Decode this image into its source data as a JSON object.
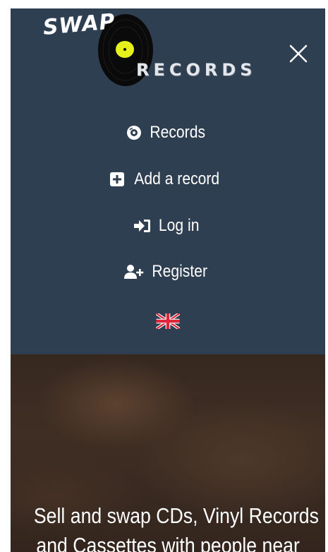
{
  "brand": {
    "logo_word_top": "SWAP",
    "logo_word_bottom": "RECORDS",
    "colors": {
      "nav_background": "#2f3f52",
      "disc": "#0a0a0a",
      "disc_label": "#e8f01c",
      "text": "#ffffff"
    }
  },
  "nav": {
    "close_icon": "close-icon",
    "items": [
      {
        "label": "Records",
        "icon": "vinyl-icon"
      },
      {
        "label": "Add a record",
        "icon": "plus-square-icon"
      },
      {
        "label": "Log in",
        "icon": "sign-in-icon"
      },
      {
        "label": "Register",
        "icon": "user-plus-icon"
      }
    ],
    "language_icon": "uk-flag-icon"
  },
  "hero": {
    "line1": "Sell and swap CDs, Vinyl Records",
    "line2": "and Cassettes with people near"
  }
}
